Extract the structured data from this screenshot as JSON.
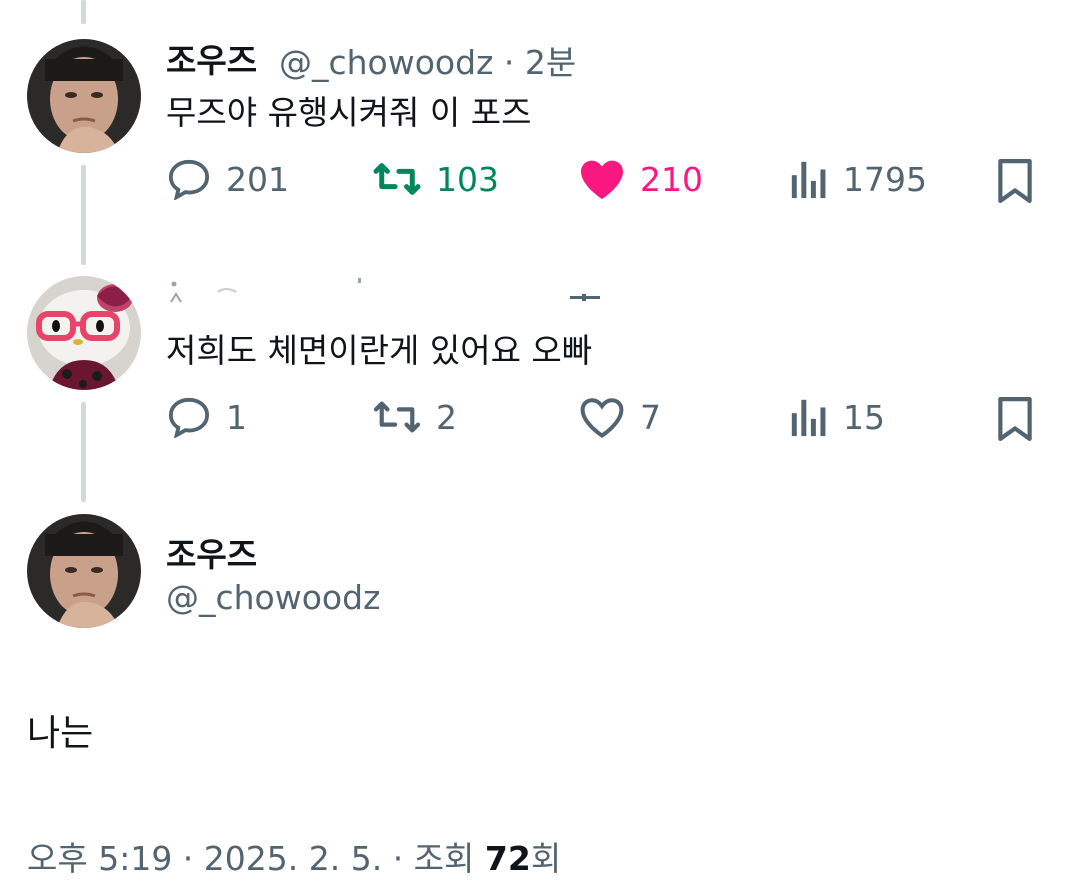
{
  "tweet1": {
    "name": "조우즈",
    "handle_time": "@_chowoodz · 2분",
    "text": "무즈야 유행시켜줘 이 포즈",
    "replies": "201",
    "retweets": "103",
    "likes": "210",
    "views": "1795",
    "retweet_color": "#00875a",
    "like_color": "#f91880"
  },
  "tweet2": {
    "text": "저희도 체면이란게 있어요 오빠",
    "replies": "1",
    "retweets": "2",
    "likes": "7",
    "views": "15"
  },
  "main": {
    "name": "조우즈",
    "handle": "@_chowoodz",
    "text": "나는",
    "footer_prefix": "오후 5:19 · 2025. 2. 5. · 조회 ",
    "footer_count": "72",
    "footer_suffix": "회"
  },
  "icons": {
    "reply": "speech-bubble-icon",
    "retweet": "retweet-arrows-icon",
    "like": "heart-icon",
    "views": "bar-chart-icon",
    "bookmark": "bookmark-icon"
  }
}
